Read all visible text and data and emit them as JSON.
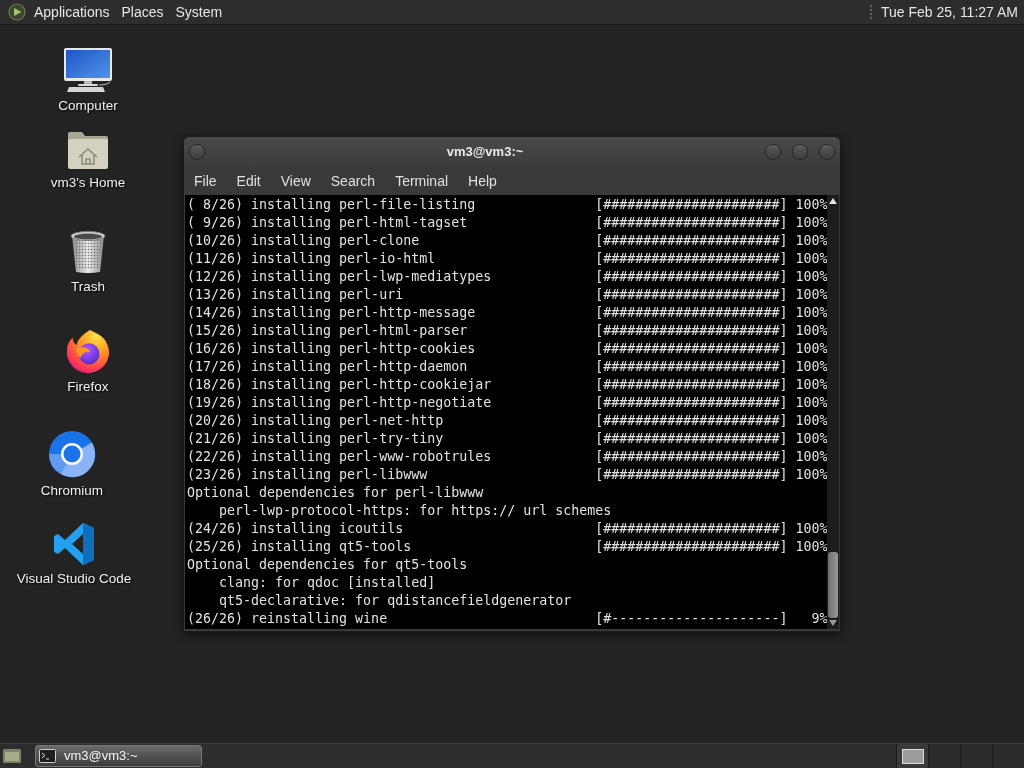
{
  "top_panel": {
    "menus": [
      "Applications",
      "Places",
      "System"
    ],
    "clock": "Tue Feb 25, 11:27 AM"
  },
  "desktop_icons": [
    {
      "kind": "computer",
      "label": "Computer"
    },
    {
      "kind": "home",
      "label": "vm3's Home"
    },
    {
      "kind": "trash",
      "label": "Trash"
    },
    {
      "kind": "firefox",
      "label": "Firefox"
    },
    {
      "kind": "chromium",
      "label": "Chromium"
    },
    {
      "kind": "vscode",
      "label": "Visual Studio Code"
    }
  ],
  "terminal": {
    "title": "vm3@vm3:~",
    "menu": [
      "File",
      "Edit",
      "View",
      "Search",
      "Terminal",
      "Help"
    ],
    "lines": [
      {
        "kind": "progress",
        "label": "( 8/26) installing perl-file-listing",
        "bar": "[######################]",
        "percent": "100%"
      },
      {
        "kind": "progress",
        "label": "( 9/26) installing perl-html-tagset",
        "bar": "[######################]",
        "percent": "100%"
      },
      {
        "kind": "progress",
        "label": "(10/26) installing perl-clone",
        "bar": "[######################]",
        "percent": "100%"
      },
      {
        "kind": "progress",
        "label": "(11/26) installing perl-io-html",
        "bar": "[######################]",
        "percent": "100%"
      },
      {
        "kind": "progress",
        "label": "(12/26) installing perl-lwp-mediatypes",
        "bar": "[######################]",
        "percent": "100%"
      },
      {
        "kind": "progress",
        "label": "(13/26) installing perl-uri",
        "bar": "[######################]",
        "percent": "100%"
      },
      {
        "kind": "progress",
        "label": "(14/26) installing perl-http-message",
        "bar": "[######################]",
        "percent": "100%"
      },
      {
        "kind": "progress",
        "label": "(15/26) installing perl-html-parser",
        "bar": "[######################]",
        "percent": "100%"
      },
      {
        "kind": "progress",
        "label": "(16/26) installing perl-http-cookies",
        "bar": "[######################]",
        "percent": "100%"
      },
      {
        "kind": "progress",
        "label": "(17/26) installing perl-http-daemon",
        "bar": "[######################]",
        "percent": "100%"
      },
      {
        "kind": "progress",
        "label": "(18/26) installing perl-http-cookiejar",
        "bar": "[######################]",
        "percent": "100%"
      },
      {
        "kind": "progress",
        "label": "(19/26) installing perl-http-negotiate",
        "bar": "[######################]",
        "percent": "100%"
      },
      {
        "kind": "progress",
        "label": "(20/26) installing perl-net-http",
        "bar": "[######################]",
        "percent": "100%"
      },
      {
        "kind": "progress",
        "label": "(21/26) installing perl-try-tiny",
        "bar": "[######################]",
        "percent": "100%"
      },
      {
        "kind": "progress",
        "label": "(22/26) installing perl-www-robotrules",
        "bar": "[######################]",
        "percent": "100%"
      },
      {
        "kind": "progress",
        "label": "(23/26) installing perl-libwww",
        "bar": "[######################]",
        "percent": "100%"
      },
      {
        "kind": "note",
        "text": "Optional dependencies for perl-libwww"
      },
      {
        "kind": "detail",
        "text": "perl-lwp-protocol-https: for https:// url schemes"
      },
      {
        "kind": "progress",
        "label": "(24/26) installing icoutils",
        "bar": "[######################]",
        "percent": "100%"
      },
      {
        "kind": "progress",
        "label": "(25/26) installing qt5-tools",
        "bar": "[######################]",
        "percent": "100%"
      },
      {
        "kind": "note",
        "text": "Optional dependencies for qt5-tools"
      },
      {
        "kind": "detail",
        "text": "clang: for qdoc [installed]"
      },
      {
        "kind": "detail",
        "text": "qt5-declarative: for qdistancefieldgenerator"
      },
      {
        "kind": "progress",
        "label": "(26/26) reinstalling wine",
        "bar": "[#---------------------]",
        "percent": "9%"
      }
    ]
  },
  "taskbar": {
    "tasks": [
      {
        "label": "vm3@vm3:~",
        "selected": true
      }
    ]
  }
}
